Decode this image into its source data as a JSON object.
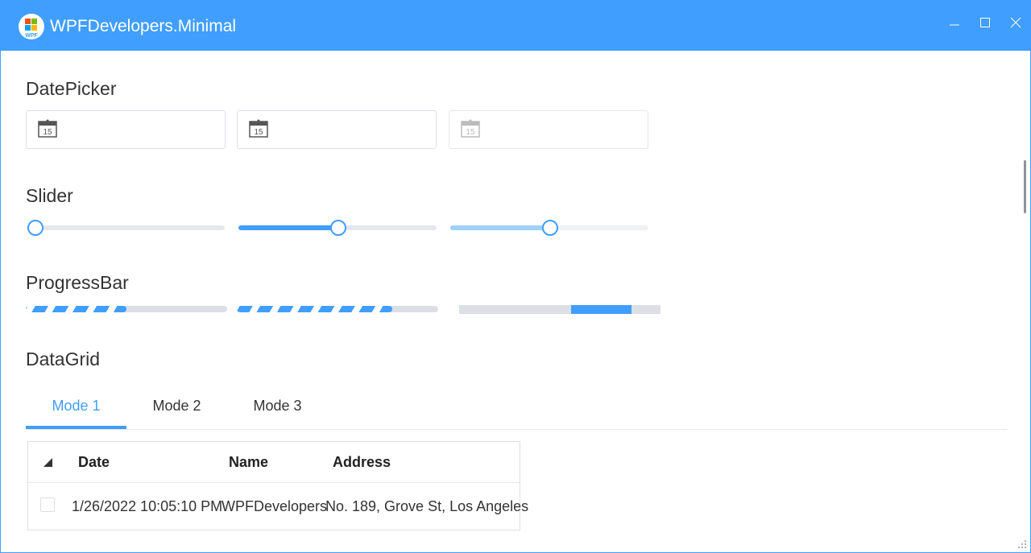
{
  "window": {
    "title": "WPFDevelopers.Minimal",
    "logo_text": "WPF",
    "accent": "#409EFE"
  },
  "sections": {
    "datepicker": "DatePicker",
    "slider": "Slider",
    "progressbar": "ProgressBar",
    "datagrid": "DataGrid"
  },
  "datepickers": [
    {
      "icon": "calendar-icon",
      "day": "15",
      "enabled": true
    },
    {
      "icon": "calendar-icon",
      "day": "15",
      "enabled": true
    },
    {
      "icon": "calendar-icon",
      "day": "15",
      "enabled": false
    }
  ],
  "sliders": [
    {
      "value": 0,
      "enabled": true
    },
    {
      "value": 0.5,
      "enabled": true
    },
    {
      "value": 0.5,
      "enabled": false
    }
  ],
  "progressbars": [
    {
      "value": 0.5,
      "style": "striped"
    },
    {
      "value": 0.77,
      "style": "striped"
    },
    {
      "style": "indeterminate"
    }
  ],
  "tabs": [
    "Mode 1",
    "Mode 2",
    "Mode 3"
  ],
  "active_tab": 0,
  "datagrid": {
    "columns": [
      "Date",
      "Name",
      "Address"
    ],
    "rows": [
      {
        "date": "1/26/2022 10:05:10 PM",
        "name": "WPFDevelopers",
        "address": "No. 189, Grove St, Los Angeles"
      }
    ]
  }
}
